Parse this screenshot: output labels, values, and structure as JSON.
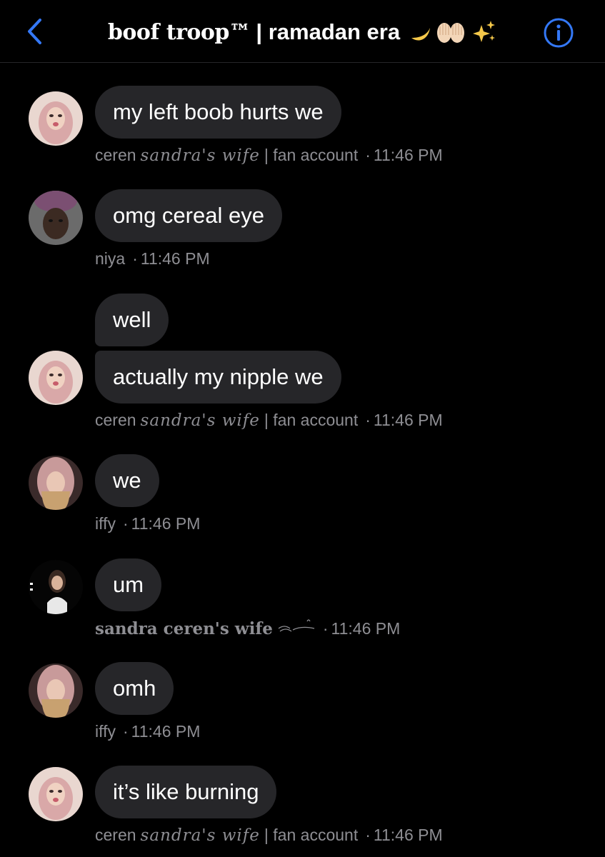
{
  "header": {
    "title_part1": "boof troop™",
    "title_part2": "| ramadan era",
    "title_emojis": [
      "crescent-moon-icon",
      "raised-hands-icon",
      "sparkles-icon"
    ],
    "accent_color": "#3478f6"
  },
  "messages": [
    {
      "sender_prefix": "ceren",
      "sender_script": "sandra's wife",
      "sender_suffix": "| fan account",
      "time": "11:46 PM",
      "text": "my left boob hurts we"
    },
    {
      "sender": "niya",
      "time": "11:46 PM",
      "text": "omg cereal eye"
    },
    {
      "text": "well"
    },
    {
      "sender_prefix": "ceren",
      "sender_script": "sandra's wife",
      "sender_suffix": "| fan account",
      "time": "11:46 PM",
      "text": "actually my nipple we"
    },
    {
      "sender": "iffy",
      "time": "11:46 PM",
      "text": "we"
    },
    {
      "sender_serif": "sandra ceren's wife",
      "time": "11:46 PM",
      "text": "um"
    },
    {
      "sender": "iffy",
      "time": "11:46 PM",
      "text": "omh"
    },
    {
      "sender_prefix": "ceren",
      "sender_script": "sandra's wife",
      "sender_suffix": "| fan account",
      "time": "11:46 PM",
      "text": "it’s like burning"
    }
  ],
  "colors": {
    "background": "#000000",
    "bubble": "#262629",
    "meta_text": "#8e8e93"
  }
}
